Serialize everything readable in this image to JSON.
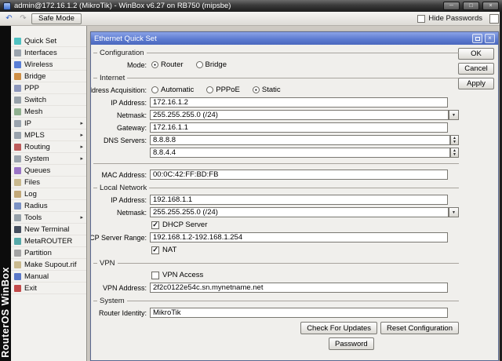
{
  "window": {
    "title": "admin@172.16.1.2 (MikroTik) - WinBox v6.27 on RB750 (mipsbe)"
  },
  "icons": {
    "minimize": "─",
    "maximize": "□",
    "close": "×",
    "undo": "↶",
    "redo": "↷",
    "dropdown": "▼",
    "spin_up": "▲",
    "spin_down": "▼",
    "dialog_close": "×"
  },
  "colors": {
    "dialog_titlebar_blue": "#5d7cd1",
    "window_titlebar_dark": "#2e2e2e",
    "sidebar_bg": "#f2f1ee"
  },
  "toolbar": {
    "safe_mode": "Safe Mode",
    "hide_passwords": "Hide Passwords",
    "hide_passwords_mark": ""
  },
  "brand": "RouterOS WinBox",
  "sidebar": {
    "items": [
      {
        "label": "Quick Set",
        "arrow": "",
        "icon_style": "background:#4fc1c1"
      },
      {
        "label": "Interfaces",
        "arrow": "",
        "icon_style": "background:#9aa3ad"
      },
      {
        "label": "Wireless",
        "arrow": "",
        "icon_style": "background:#5a7fd6"
      },
      {
        "label": "Bridge",
        "arrow": "",
        "icon_style": "background:#cf8f45"
      },
      {
        "label": "PPP",
        "arrow": "",
        "icon_style": "background:#8d97bb"
      },
      {
        "label": "Switch",
        "arrow": "",
        "icon_style": "background:#97a1a9"
      },
      {
        "label": "Mesh",
        "arrow": "",
        "icon_style": "background:#8fb08f"
      },
      {
        "label": "IP",
        "arrow": "▸",
        "icon_style": "background:#9aa3ad"
      },
      {
        "label": "MPLS",
        "arrow": "▸",
        "icon_style": "background:#9aa3ad"
      },
      {
        "label": "Routing",
        "arrow": "▸",
        "icon_style": "background:#bd5b5b"
      },
      {
        "label": "System",
        "arrow": "▸",
        "icon_style": "background:#9aa3ad"
      },
      {
        "label": "Queues",
        "arrow": "",
        "icon_style": "background:#9a74c6"
      },
      {
        "label": "Files",
        "arrow": "",
        "icon_style": "background:#c9b98e"
      },
      {
        "label": "Log",
        "arrow": "",
        "icon_style": "background:#c2a878"
      },
      {
        "label": "Radius",
        "arrow": "",
        "icon_style": "background:#7b92c4"
      },
      {
        "label": "Tools",
        "arrow": "▸",
        "icon_style": "background:#97a1a9"
      },
      {
        "label": "New Terminal",
        "arrow": "",
        "icon_style": "background:#454e5e"
      },
      {
        "label": "MetaROUTER",
        "arrow": "",
        "icon_style": "background:#55a8a8"
      },
      {
        "label": "Partition",
        "arrow": "",
        "icon_style": "background:#a3a3a3"
      },
      {
        "label": "Make Supout.rif",
        "arrow": "",
        "icon_style": "background:#c9b98e"
      },
      {
        "label": "Manual",
        "arrow": "",
        "icon_style": "background:#5a78c8"
      },
      {
        "label": "Exit",
        "arrow": "",
        "icon_style": "background:#c24a4a"
      }
    ]
  },
  "dialog": {
    "title": "Ethernet Quick Set",
    "side_buttons": {
      "ok": "OK",
      "cancel": "Cancel",
      "apply": "Apply"
    },
    "bottom_buttons": {
      "check_updates": "Check For Updates",
      "reset_config": "Reset Configuration",
      "password": "Password"
    },
    "sections": {
      "configuration": "Configuration",
      "internet": "Internet",
      "local_network": "Local Network",
      "vpn": "VPN",
      "system": "System"
    },
    "configuration": {
      "mode_label": "Mode:",
      "mode_options": [
        {
          "label": "Router",
          "dot": "●"
        },
        {
          "label": "Bridge",
          "dot": ""
        }
      ]
    },
    "internet": {
      "acquisition_label": "Address Acquisition:",
      "acquisition_options": [
        {
          "label": "Automatic",
          "dot": ""
        },
        {
          "label": "PPPoE",
          "dot": ""
        },
        {
          "label": "Static",
          "dot": "●"
        }
      ],
      "ip_label": "IP Address:",
      "ip_value": "172.16.1.2",
      "netmask_label": "Netmask:",
      "netmask_value": "255.255.255.0 (/24)",
      "gateway_label": "Gateway:",
      "gateway_value": "172.16.1.1",
      "dns_label": "DNS Servers:",
      "dns_values": [
        "8.8.8.8",
        "8.8.4.4"
      ],
      "mac_label": "MAC Address:",
      "mac_value": "00:0C:42:FF:BD:FB"
    },
    "local_network": {
      "ip_label": "IP Address:",
      "ip_value": "192.168.1.1",
      "netmask_label": "Netmask:",
      "netmask_value": "255.255.255.0 (/24)",
      "dhcp_label": "DHCP Server",
      "dhcp_mark": "✓",
      "dhcp_range_label": "DHCP Server Range:",
      "dhcp_range_value": "192.168.1.2-192.168.1.254",
      "nat_label": "NAT",
      "nat_mark": "✓"
    },
    "vpn": {
      "access_label": "VPN Access",
      "access_mark": "",
      "address_label": "VPN Address:",
      "address_value": "2f2c0122e54c.sn.mynetname.net"
    },
    "system": {
      "identity_label": "Router Identity:",
      "identity_value": "MikroTik"
    }
  }
}
